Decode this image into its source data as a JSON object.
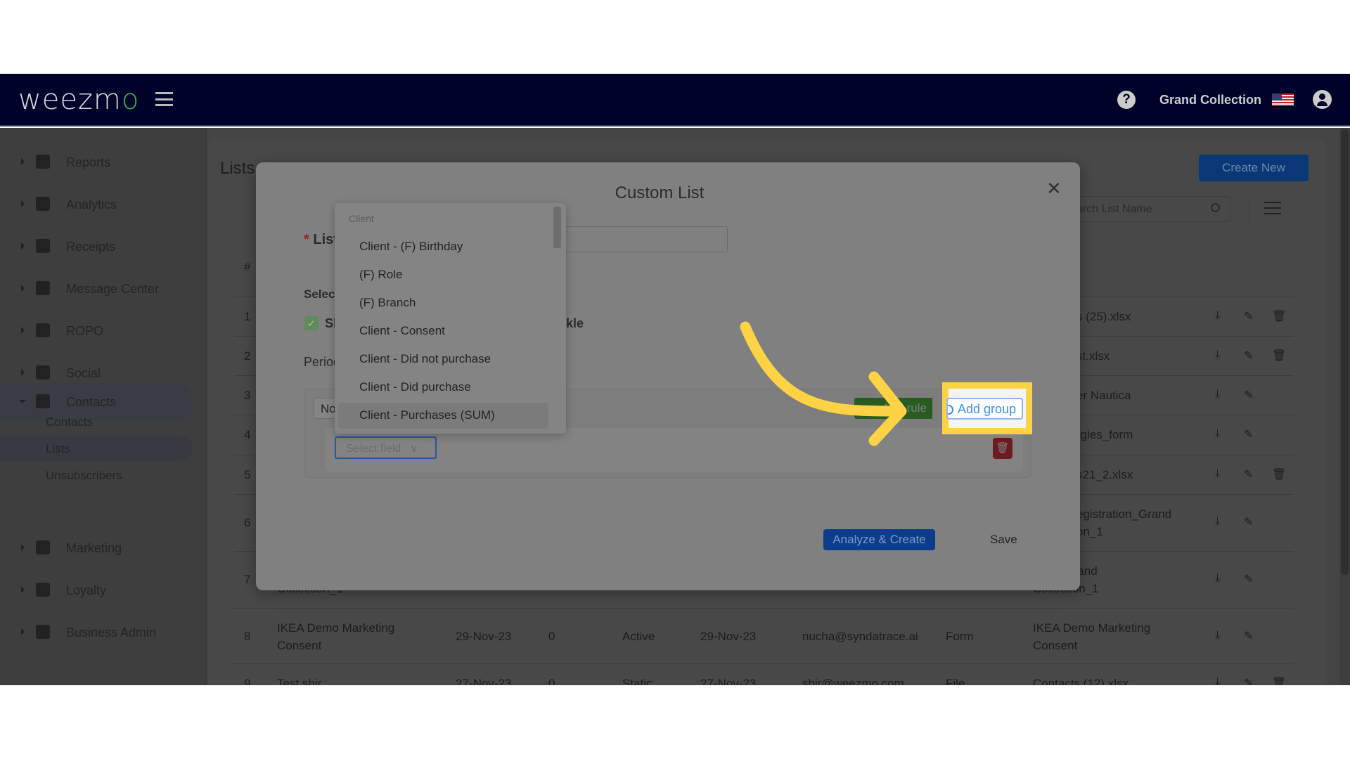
{
  "header": {
    "logo": "weezmo",
    "org_name": "Grand Collection",
    "help_icon": "help-circle-icon",
    "flag_icon": "us-flag-icon",
    "avatar_icon": "user-circle-icon"
  },
  "sidebar": {
    "items": [
      {
        "label": "Reports",
        "icon": "dashboard-icon"
      },
      {
        "label": "Analytics",
        "icon": "bar-chart-icon"
      },
      {
        "label": "Receipts",
        "icon": "receipt-icon"
      },
      {
        "label": "Message Center",
        "icon": "chat-icon"
      },
      {
        "label": "ROPO",
        "icon": "infinity-icon"
      },
      {
        "label": "Social",
        "icon": "people-icon"
      },
      {
        "label": "Contacts",
        "icon": "contact-card-icon"
      },
      {
        "label": "Marketing",
        "icon": "party-popper-icon"
      },
      {
        "label": "Loyalty",
        "icon": "tag-heart-icon"
      },
      {
        "label": "Business Admin",
        "icon": "gear-icon"
      }
    ],
    "contacts_sub": [
      "Contacts",
      "Lists",
      "Unsubscribers"
    ]
  },
  "page": {
    "title": "Lists",
    "create_new": "Create New",
    "search_placeholder": "arch List Name",
    "table_hash": "#"
  },
  "table": {
    "rows": [
      {
        "n": "1",
        "source": "s (25).xlsx",
        "delete": true
      },
      {
        "n": "2",
        "source": "st.xlsx",
        "delete": true
      },
      {
        "n": "3",
        "source": "er Nautica",
        "delete": false
      },
      {
        "n": "4",
        "source": "rgies_form",
        "delete": false
      },
      {
        "n": "5",
        "source": "s21_2.xlsx",
        "delete": true
      },
      {
        "n": "6",
        "source": "egistration_Grand",
        "source2": "on_1",
        "delete": false
      },
      {
        "n": "7",
        "name2": "Collection_1",
        "source": "yalty_Grand",
        "source2": "Collection_1",
        "delete": false
      },
      {
        "n": "8",
        "name": "IKEA Demo Marketing",
        "name2": "Consent",
        "created": "29-Nov-23",
        "count": "0",
        "status": "Active",
        "updated": "29-Nov-23",
        "owner": "nucha@syndatrace.ai",
        "type": "Form",
        "source": "IKEA Demo Marketing",
        "source2": "Consent",
        "delete": false
      },
      {
        "n": "9",
        "name": "Test shir",
        "created": "27-Nov-23",
        "count": "0",
        "status": "Static",
        "updated": "27-Nov-23",
        "owner": "shir@weezmo.com",
        "type": "File",
        "source": "Contacts (12).xlsx",
        "delete": true
      }
    ]
  },
  "modal": {
    "title": "Custom List",
    "list_label": "List",
    "select_label": "Selec",
    "checkbox_label_start": "Sl",
    "checkbox_label_end": "kle",
    "checkbox_checked": true,
    "period_label": "Period",
    "not_button": "No",
    "select_field_placeholder": "Select field",
    "add_rule": "Add rule",
    "add_group": "Add group",
    "analyze_create": "Analyze & Create",
    "save": "Save"
  },
  "dropdown": {
    "group": "Client",
    "items": [
      "Client - (F) Birthday",
      "(F) Role",
      "(F) Branch",
      "Client - Consent",
      "Client - Did not purchase",
      "Client - Did purchase",
      "Client - Purchases (SUM)"
    ],
    "highlighted": "Client - Purchases (SUM)"
  },
  "annotation": {
    "highlight_color": "#fdd245",
    "target": "Add group"
  }
}
